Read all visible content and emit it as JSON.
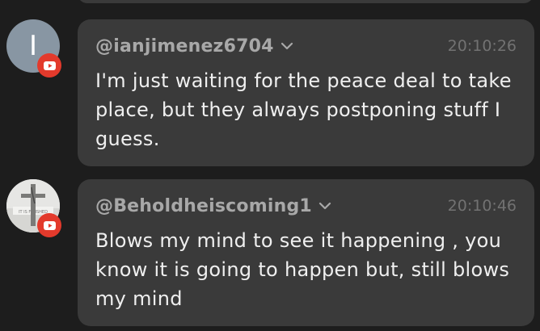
{
  "comments": [
    {
      "avatar_letter": "I",
      "username": "@ianjimenez6704",
      "timestamp": "20:10:26",
      "message": "I'm just waiting for the peace deal to take place, but they always postponing stuff I guess."
    },
    {
      "avatar_letter": "",
      "username": "@Beholdheiscoming1",
      "timestamp": "20:10:46",
      "message": "Blows my mind to see it happening , you know it is going to happen but, still blows my mind"
    }
  ],
  "icons": {
    "platform_badge": "youtube-icon",
    "expand": "chevron-down-icon"
  },
  "colors": {
    "background": "#1d1d1d",
    "bubble": "#3a3a3a",
    "youtube_red": "#e33a2c",
    "avatar_default": "#8896a3"
  }
}
